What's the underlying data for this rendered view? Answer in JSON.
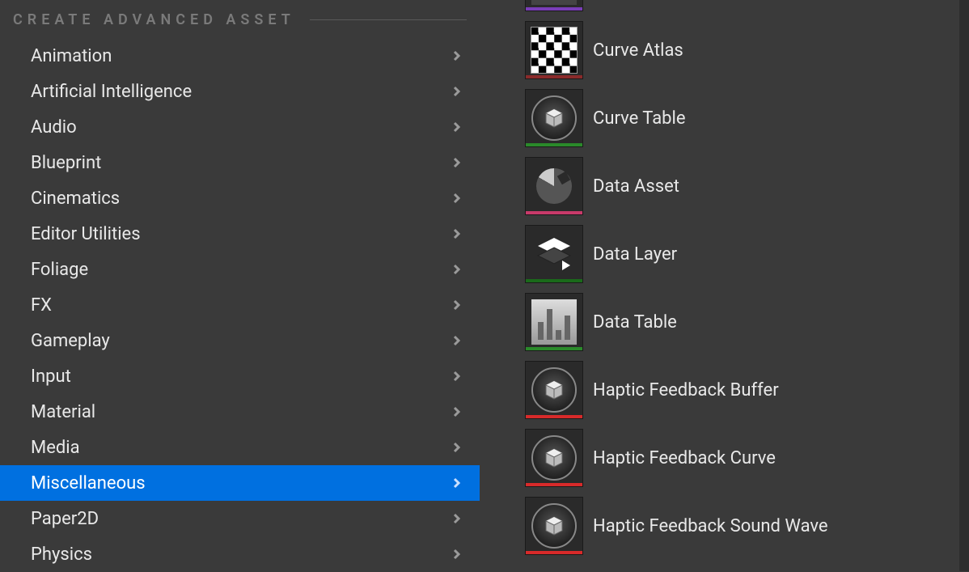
{
  "section": {
    "title": "CREATE ADVANCED ASSET"
  },
  "categories": [
    {
      "label": "Animation",
      "selected": false
    },
    {
      "label": "Artificial Intelligence",
      "selected": false
    },
    {
      "label": "Audio",
      "selected": false
    },
    {
      "label": "Blueprint",
      "selected": false
    },
    {
      "label": "Cinematics",
      "selected": false
    },
    {
      "label": "Editor Utilities",
      "selected": false
    },
    {
      "label": "Foliage",
      "selected": false
    },
    {
      "label": "FX",
      "selected": false
    },
    {
      "label": "Gameplay",
      "selected": false
    },
    {
      "label": "Input",
      "selected": false
    },
    {
      "label": "Material",
      "selected": false
    },
    {
      "label": "Media",
      "selected": false
    },
    {
      "label": "Miscellaneous",
      "selected": true
    },
    {
      "label": "Paper2D",
      "selected": false
    },
    {
      "label": "Physics",
      "selected": false
    }
  ],
  "assets": [
    {
      "label": "",
      "icon": "placeholder",
      "underline": "purple",
      "partial": true
    },
    {
      "label": "Curve Atlas",
      "icon": "checker",
      "underline": "red-dark"
    },
    {
      "label": "Curve Table",
      "icon": "cube-circle",
      "underline": "green"
    },
    {
      "label": "Data Asset",
      "icon": "pie",
      "underline": "pink"
    },
    {
      "label": "Data Layer",
      "icon": "layers",
      "underline": "green-dark"
    },
    {
      "label": "Data Table",
      "icon": "bars",
      "underline": "green2"
    },
    {
      "label": "Haptic Feedback Buffer",
      "icon": "cube-circle",
      "underline": "red"
    },
    {
      "label": "Haptic Feedback Curve",
      "icon": "cube-circle",
      "underline": "red"
    },
    {
      "label": "Haptic Feedback Sound Wave",
      "icon": "cube-circle",
      "underline": "red"
    }
  ]
}
